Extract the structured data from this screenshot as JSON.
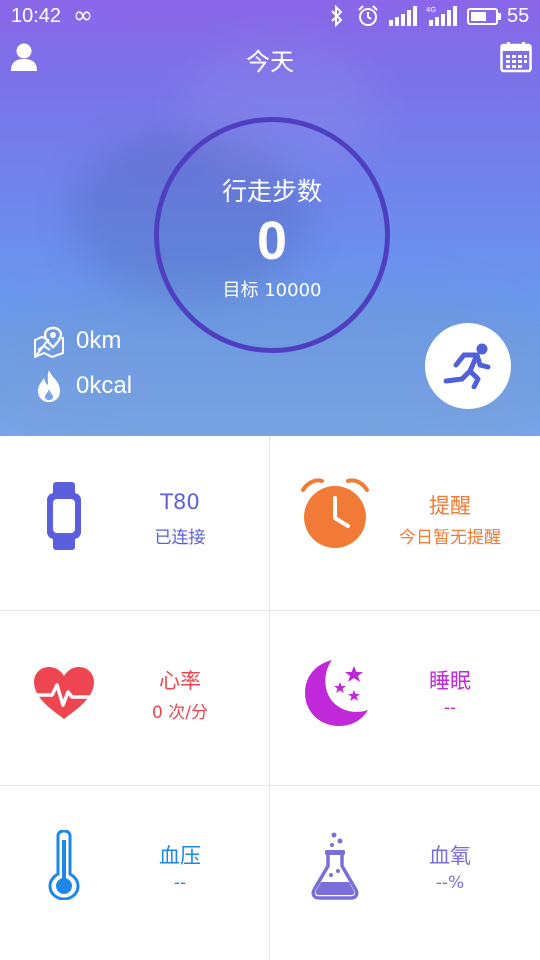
{
  "status_bar": {
    "time": "10:42",
    "infinity": "∞",
    "battery_level": "55"
  },
  "header": {
    "title": "今天"
  },
  "steps": {
    "label": "行走步数",
    "count": "0",
    "goal": "目标 10000"
  },
  "stats": {
    "distance": "0km",
    "calories": "0kcal"
  },
  "cards": {
    "device": {
      "title": "T80",
      "subtitle": "已连接"
    },
    "reminder": {
      "title": "提醒",
      "subtitle": "今日暂无提醒"
    },
    "heart_rate": {
      "title": "心率",
      "subtitle": "0 次/分"
    },
    "sleep": {
      "title": "睡眠",
      "subtitle": "--"
    },
    "blood_pressure": {
      "title": "血压",
      "subtitle": "--"
    },
    "blood_oxygen": {
      "title": "血氧",
      "subtitle": "--%"
    }
  },
  "colors": {
    "device": "#5b5fdd",
    "reminder": "#f07a36",
    "heart_rate": "#ee4650",
    "sleep": "#bf29d9",
    "blood_pressure": "#1e86e6",
    "blood_oxygen": "#7a6fd8",
    "ring": "#4e3fc0"
  },
  "icons": {
    "user": "user-icon",
    "calendar": "calendar-icon",
    "distance": "map-pin-icon",
    "calories": "flame-icon",
    "run": "running-icon",
    "device": "watch-icon",
    "reminder": "alarm-clock-icon",
    "heart_rate": "heart-pulse-icon",
    "sleep": "moon-stars-icon",
    "blood_pressure": "thermometer-icon",
    "blood_oxygen": "flask-icon"
  }
}
